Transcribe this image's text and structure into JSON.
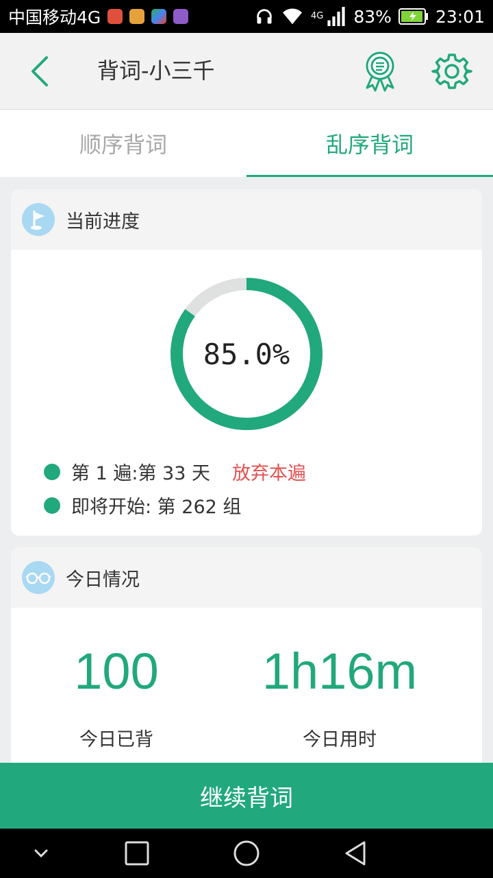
{
  "status_bar": {
    "carrier": "中国移动4G",
    "network": "4G",
    "battery": "83%",
    "time": "23:01",
    "notification_icons": [
      "mail-icon",
      "lock-app-icon",
      "play-store-icon",
      "image-icon"
    ]
  },
  "app_bar": {
    "title": "背词-小三千",
    "back_icon": "chevron-left-icon",
    "award_icon": "award-ribbon-icon",
    "settings_icon": "gear-icon"
  },
  "tabs": [
    {
      "label": "顺序背词",
      "active": false
    },
    {
      "label": "乱序背词",
      "active": true
    }
  ],
  "progress": {
    "header": "当前进度",
    "percent_label": "85.0%",
    "percent_value": 85.0,
    "round_text": "第 1 遍:第 33 天",
    "abandon_label": "放弃本遍",
    "next_text": "即将开始: 第 262 组"
  },
  "today": {
    "header": "今日情况",
    "count_value": "100",
    "count_label": "今日已背",
    "time_value": "1h16m",
    "time_label": "今日用时"
  },
  "continue_label": "继续背词",
  "colors": {
    "accent": "#21a87c",
    "ring_track": "#dfe0e0",
    "danger": "#e25050",
    "header_icon_bg": "#a9d8f2"
  }
}
